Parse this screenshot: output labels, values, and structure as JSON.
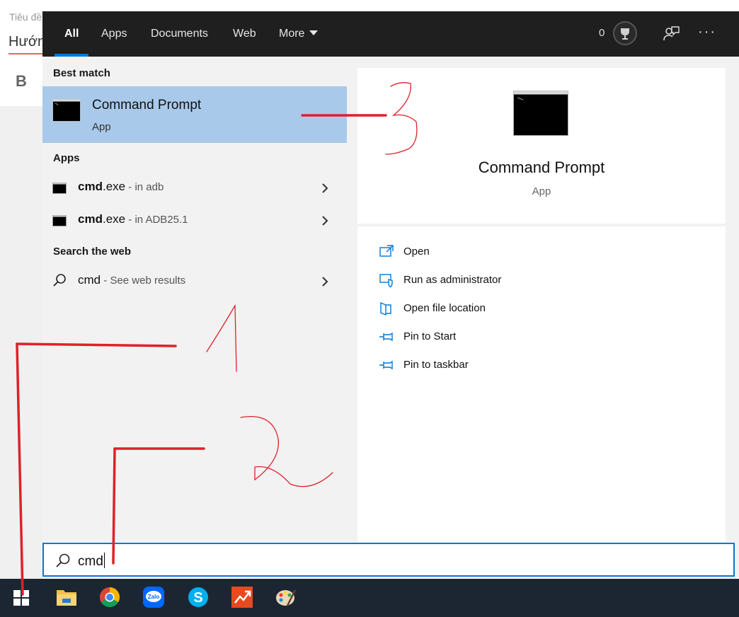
{
  "background_doc": {
    "title_partial": "Tiêu đề",
    "heading_partial": "Hướn",
    "bold_button": "B"
  },
  "tabs": [
    "All",
    "Apps",
    "Documents",
    "Web",
    "More"
  ],
  "header": {
    "rewards_count": "0"
  },
  "best_match": {
    "section": "Best match",
    "title": "Command Prompt",
    "subtitle": "App"
  },
  "apps": {
    "section": "Apps",
    "items": [
      {
        "name": "cmd",
        "ext": ".exe",
        "location": " - in adb"
      },
      {
        "name": "cmd",
        "ext": ".exe",
        "location": " - in ADB25.1"
      }
    ]
  },
  "web": {
    "section": "Search the web",
    "query": "cmd",
    "hint": " - See web results"
  },
  "preview": {
    "title": "Command Prompt",
    "subtitle": "App",
    "actions": [
      "Open",
      "Run as administrator",
      "Open file location",
      "Pin to Start",
      "Pin to taskbar"
    ]
  },
  "search": {
    "query": "cmd"
  },
  "colors": {
    "accent": "#0078d7",
    "highlight": "#a9c9ea",
    "annotation": "#e0202a"
  },
  "annotations": [
    "1",
    "2",
    "3"
  ]
}
